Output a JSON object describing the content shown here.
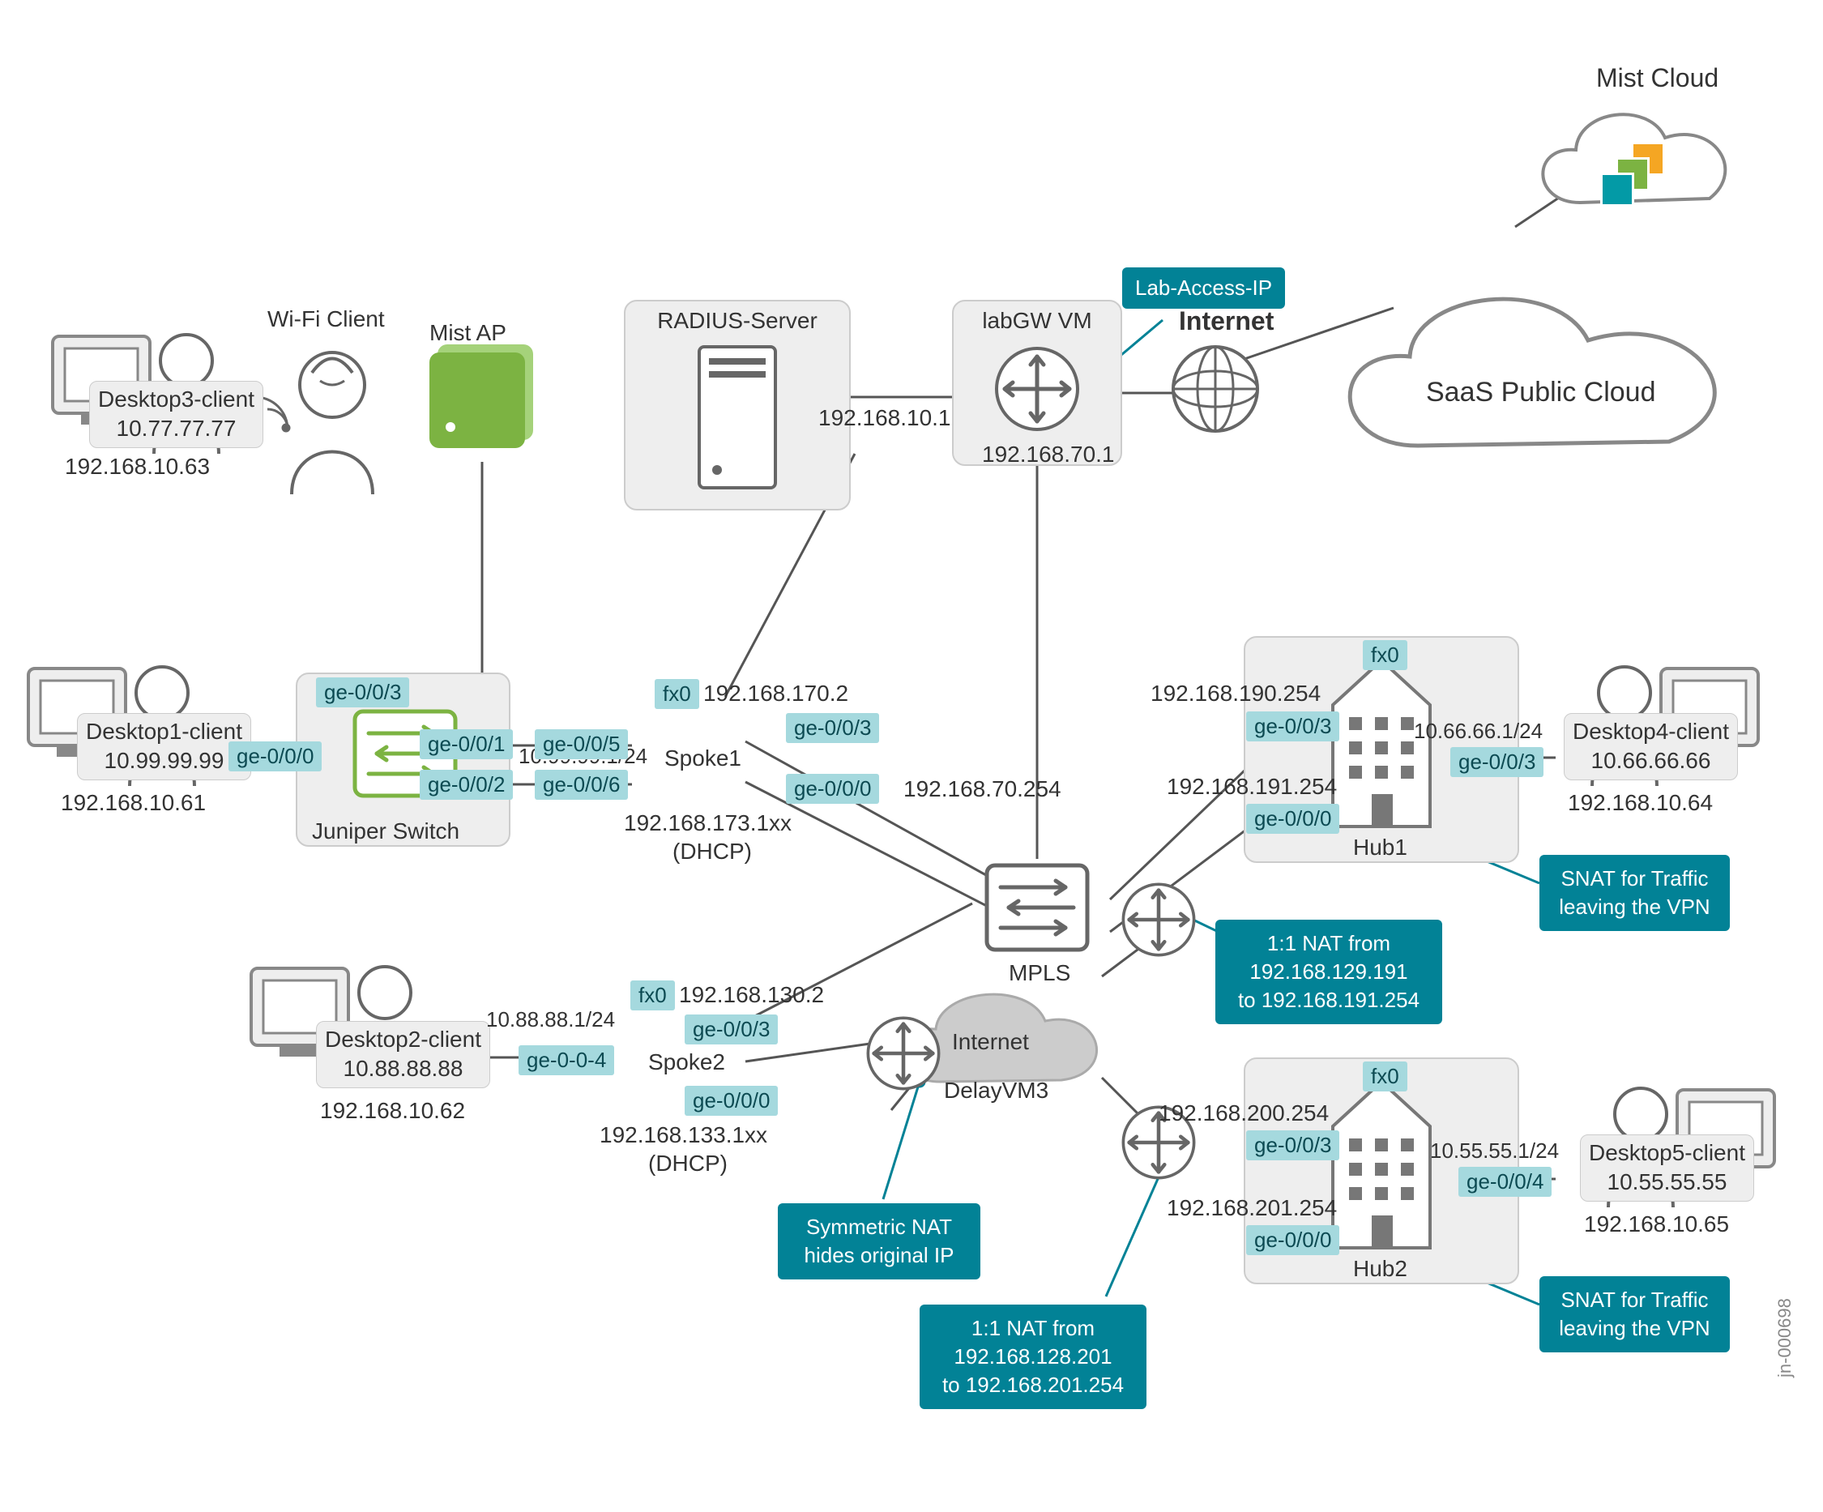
{
  "diagram_id": "jn-000698",
  "title": "Mist Cloud",
  "labels": {
    "wifi_client": "Wi-Fi Client",
    "mist_ap": "Mist AP",
    "radius_server": "RADIUS-Server",
    "labgw": "labGW VM",
    "internet": "Internet",
    "saas_cloud": "SaaS Public Cloud",
    "mist_cloud": "Mist Cloud",
    "juniper_switch": "Juniper Switch",
    "spoke1": "Spoke1",
    "spoke2": "Spoke2",
    "mpls": "MPLS",
    "delayvm3": "DelayVM3",
    "internet_cloud": "Internet",
    "hub1": "Hub1",
    "hub2": "Hub2",
    "lab_access_ip": "Lab-Access-IP"
  },
  "desktops": {
    "d1": {
      "name": "Desktop1-client",
      "ip_inner": "10.99.99.99",
      "ip_outer": "192.168.10.61"
    },
    "d2": {
      "name": "Desktop2-client",
      "ip_inner": "10.88.88.88",
      "ip_outer": "192.168.10.62"
    },
    "d3": {
      "name": "Desktop3-client",
      "ip_inner": "10.77.77.77",
      "ip_outer": "192.168.10.63"
    },
    "d4": {
      "name": "Desktop4-client",
      "ip_inner": "10.66.66.66",
      "ip_outer": "192.168.10.64"
    },
    "d5": {
      "name": "Desktop5-client",
      "ip_inner": "10.55.55.55",
      "ip_outer": "192.168.10.65"
    }
  },
  "ports": {
    "sw_ge000": "ge-0/0/0",
    "sw_ge001": "ge-0/0/1",
    "sw_ge002": "ge-0/0/2",
    "sw_ge003": "ge-0/0/3",
    "sp1_ge005": "ge-0/0/5",
    "sp1_ge006": "ge-0/0/6",
    "sp1_fx0": "fx0",
    "sp1_ge003": "ge-0/0/3",
    "sp1_ge000": "ge-0/0/0",
    "sp2_fx0": "fx0",
    "sp2_ge003": "ge-0/0/3",
    "sp2_ge000": "ge-0/0/0",
    "sp2_ge004": "ge-0-0-4",
    "hub1_fx0": "fx0",
    "hub1_ge003_top": "ge-0/0/3",
    "hub1_ge003_r": "ge-0/0/3",
    "hub1_ge000": "ge-0/0/0",
    "hub2_fx0": "fx0",
    "hub2_ge003": "ge-0/0/3",
    "hub2_ge004": "ge-0/0/4",
    "hub2_ge000": "ge-0/0/0"
  },
  "ips": {
    "radius_link": "192.168.10.1",
    "labgw_bottom": "192.168.70.1",
    "sp1_fx0": "192.168.170.2",
    "sp1_dhcp": "192.168.173.1xx",
    "dhcp_suffix": "(DHCP)",
    "sp2_fx0": "192.168.130.2",
    "sp2_dhcp": "192.168.133.1xx",
    "mpls_top": "192.168.70.254",
    "hub1_top": "192.168.190.254",
    "hub1_mid": "192.168.191.254",
    "hub1_gw": "10.66.66.1/24",
    "hub2_top": "192.168.200.254",
    "hub2_mid": "192.168.201.254",
    "hub2_gw": "10.55.55.1/24",
    "sw_net": "10.99.99.1/24",
    "sp2_net": "10.88.88.1/24"
  },
  "callouts": {
    "sym_nat": "Symmetric NAT\nhides original IP",
    "nat191_l1": "1:1 NAT from",
    "nat191_l2": "192.168.129.191",
    "nat191_l3": "to 192.168.191.254",
    "nat201_l1": "1:1 NAT from",
    "nat201_l2": "192.168.128.201",
    "nat201_l3": "to 192.168.201.254",
    "snat": "SNAT for Traffic\nleaving the VPN"
  }
}
